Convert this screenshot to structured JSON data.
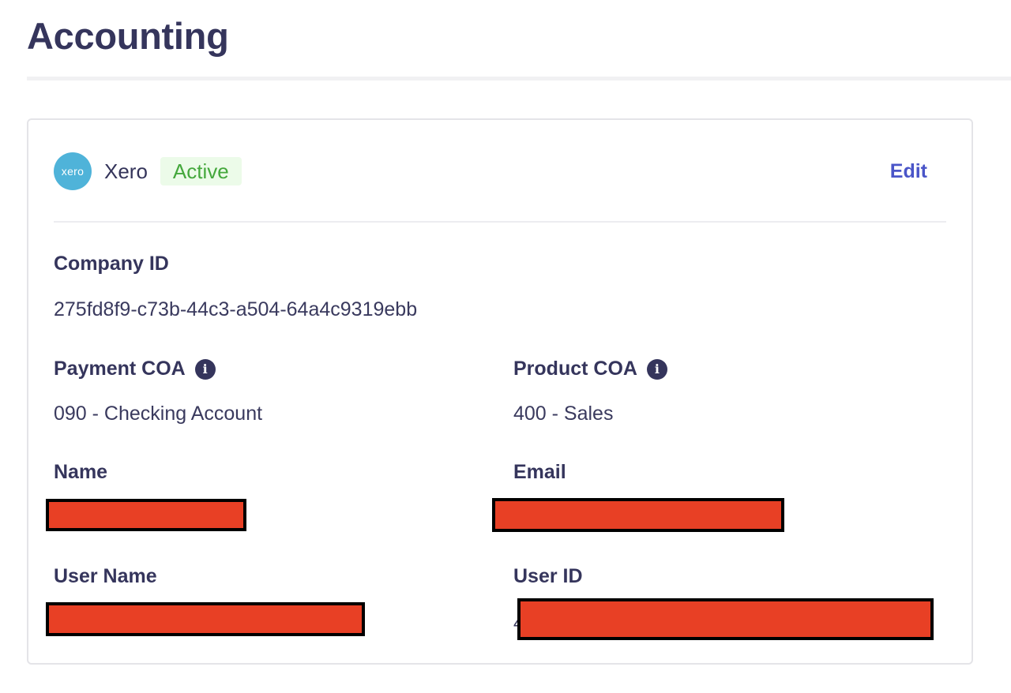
{
  "page": {
    "title": "Accounting"
  },
  "integration": {
    "provider_logo_text": "xero",
    "provider_name": "Xero",
    "status": "Active",
    "edit_label": "Edit",
    "colors": {
      "logo": "#4fb3d9",
      "status_bg": "#ecfbe9",
      "status_text": "#44a83c",
      "link": "#4a55c8",
      "redaction": "#e84025"
    }
  },
  "fields": {
    "company_id": {
      "label": "Company ID",
      "value": "275fd8f9-c73b-44c3-a504-64a4c9319ebb"
    },
    "payment_coa": {
      "label": "Payment COA",
      "value": "090 - Checking Account",
      "icon": "info-icon"
    },
    "product_coa": {
      "label": "Product COA",
      "value": "400 - Sales",
      "icon": "info-icon"
    },
    "name": {
      "label": "Name"
    },
    "email": {
      "label": "Email"
    },
    "user_name": {
      "label": "User Name"
    },
    "user_id": {
      "label": "User ID",
      "visible_fragment": "4"
    }
  }
}
